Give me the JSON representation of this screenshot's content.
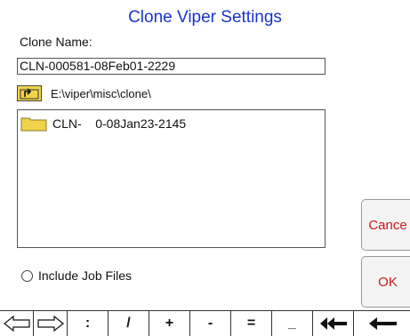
{
  "dialog": {
    "title": "Clone Viper Settings",
    "clone_name_label": "Clone Name:",
    "clone_name_value": "CLN-000581-08Feb01-2229",
    "current_path": "E:\\viper\\misc\\clone\\"
  },
  "file_list": {
    "items": [
      {
        "label": "CLN-    0-08Jan23-2145",
        "icon": "folder-icon"
      }
    ]
  },
  "buttons": {
    "cancel_label": "Cance",
    "ok_label": "OK"
  },
  "options": {
    "include_job_files_label": "Include Job Files",
    "include_job_files_checked": false
  },
  "keyboard": {
    "keys": [
      "left-arrow",
      "right-arrow",
      ":",
      "/",
      "+",
      "-",
      "=",
      "_",
      "backspace",
      "delete"
    ],
    "colon": ":",
    "slash": "/",
    "plus": "+",
    "minus": "-",
    "equals": "=",
    "underscore": "_"
  },
  "colors": {
    "title": "#1a33cc",
    "button_text": "#d01818",
    "folder": "#f0d34a"
  }
}
